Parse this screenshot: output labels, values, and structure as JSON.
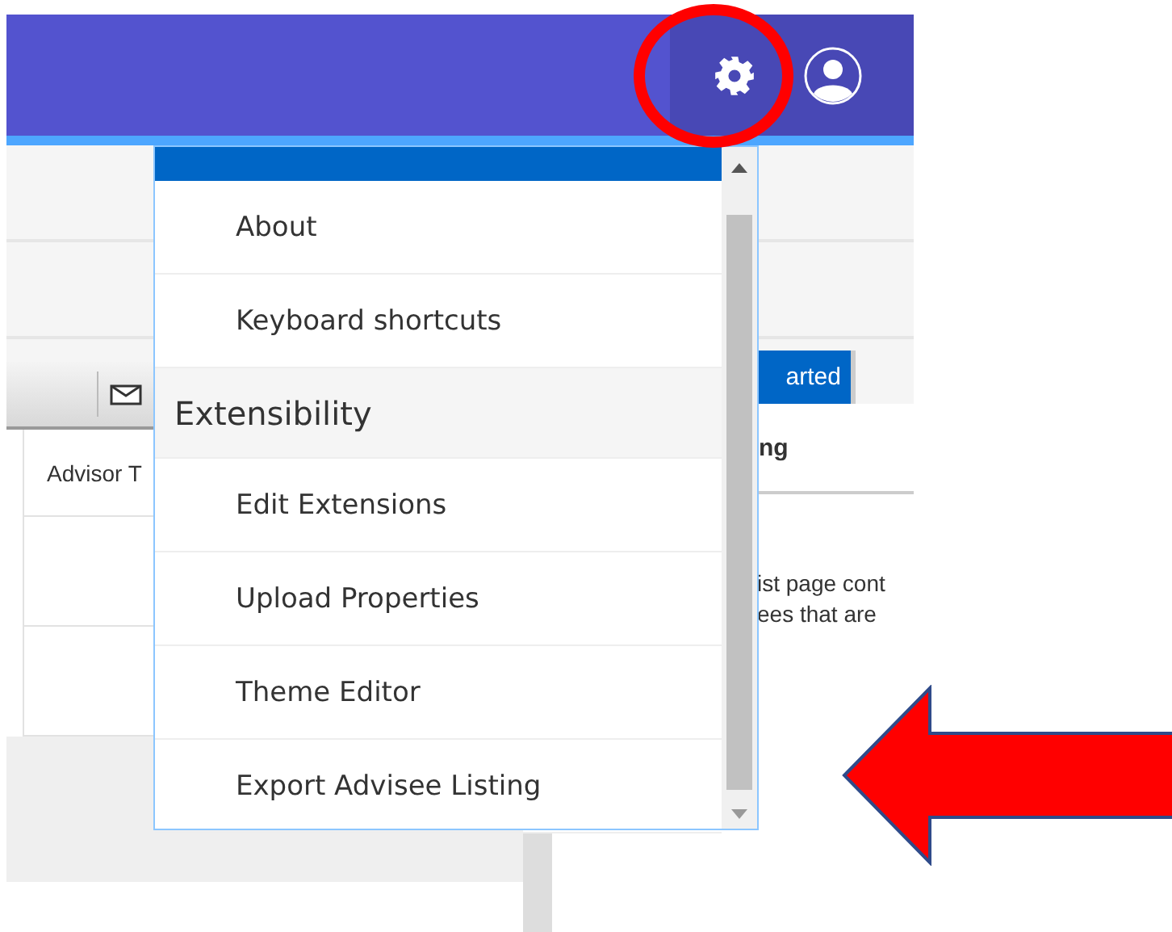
{
  "background": {
    "toolbar_column": "Advisor T",
    "tab_button": "arted",
    "panel_heading": "ng",
    "panel_text_lines": [
      "ist page cont",
      "ees that are"
    ]
  },
  "settings_menu": {
    "items": [
      {
        "kind": "item",
        "label": "About"
      },
      {
        "kind": "item",
        "label": "Keyboard shortcuts"
      },
      {
        "kind": "section",
        "label": "Extensibility"
      },
      {
        "kind": "item",
        "label": "Edit Extensions"
      },
      {
        "kind": "item",
        "label": "Upload Properties"
      },
      {
        "kind": "item",
        "label": "Theme Editor"
      },
      {
        "kind": "item",
        "label": "Export Advisee Listing"
      }
    ]
  }
}
